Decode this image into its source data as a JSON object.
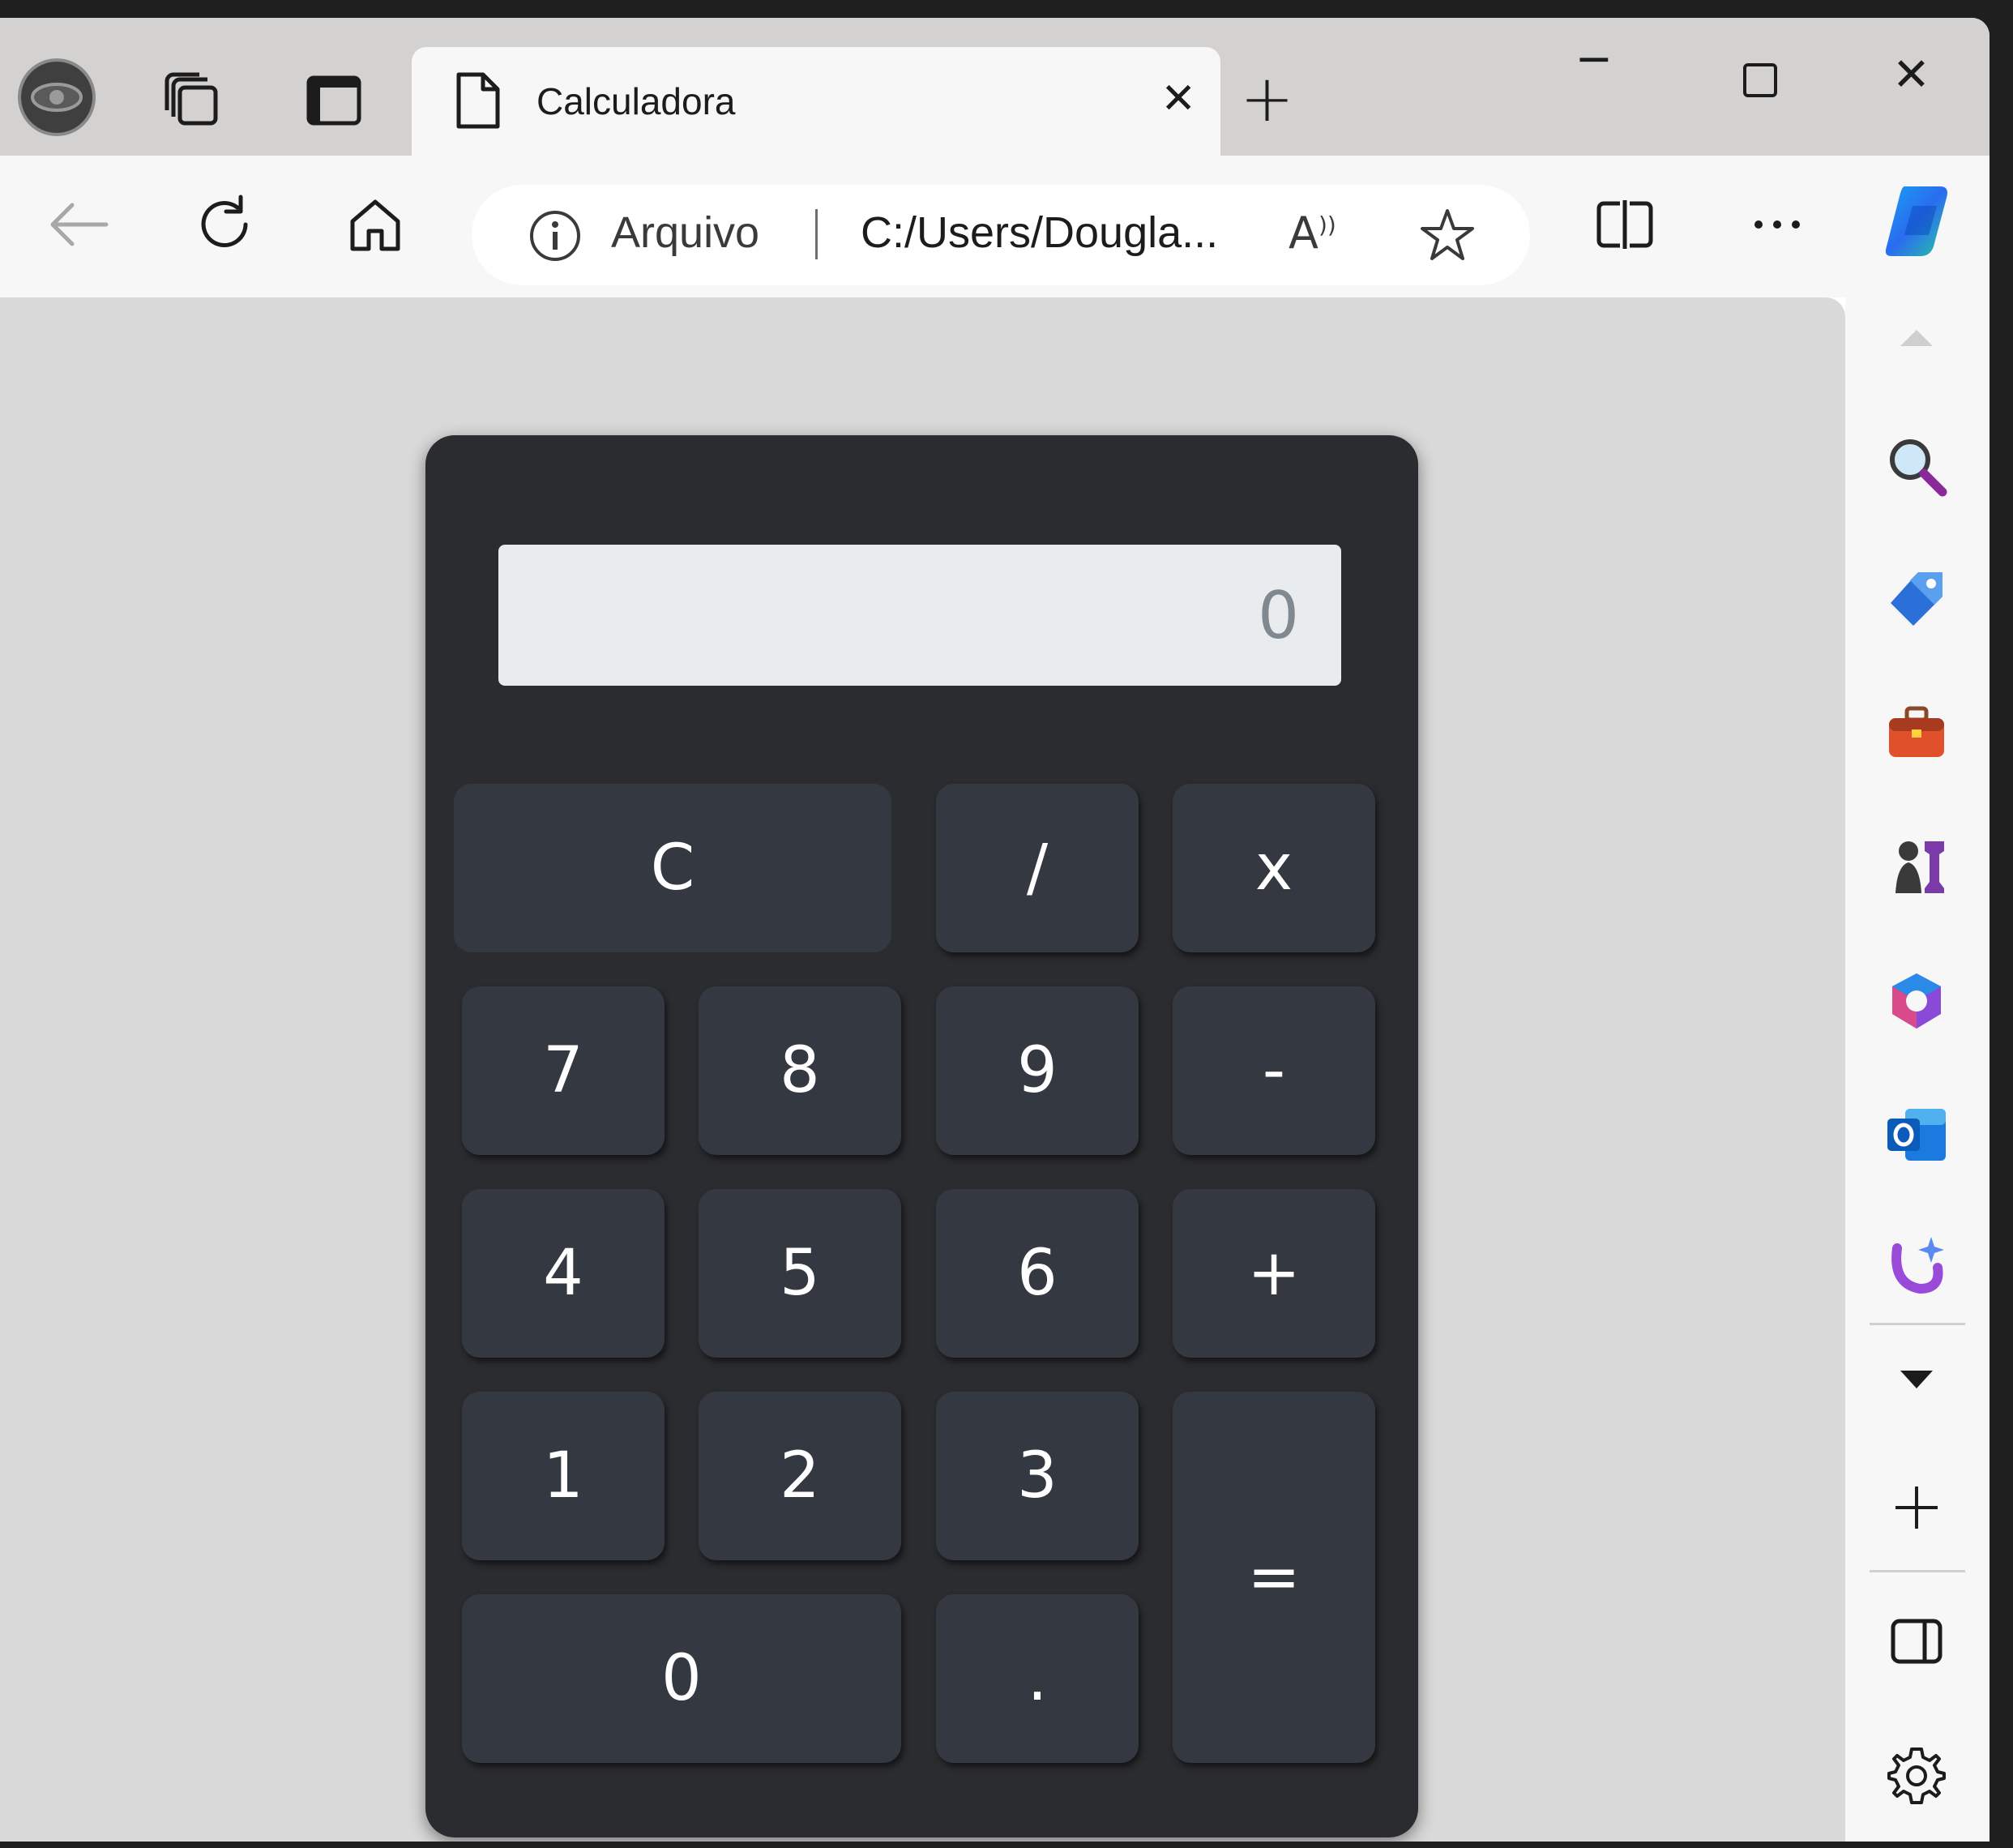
{
  "tab": {
    "title": "Calculadora"
  },
  "address": {
    "label": "Arquivo",
    "url": "C:/Users/Dougla..."
  },
  "calculator": {
    "display_value": "0",
    "keys": {
      "clear": "C",
      "divide": "/",
      "multiply": "x",
      "k7": "7",
      "k8": "8",
      "k9": "9",
      "minus": "-",
      "k4": "4",
      "k5": "5",
      "k6": "6",
      "plus": "+",
      "k1": "1",
      "k2": "2",
      "k3": "3",
      "equals": "=",
      "k0": "0",
      "dot": "."
    }
  },
  "colors": {
    "calculator_body": "#2b2c30",
    "key": "#343941",
    "display": "#e9ecef",
    "page_background": "#d9d9d9"
  }
}
